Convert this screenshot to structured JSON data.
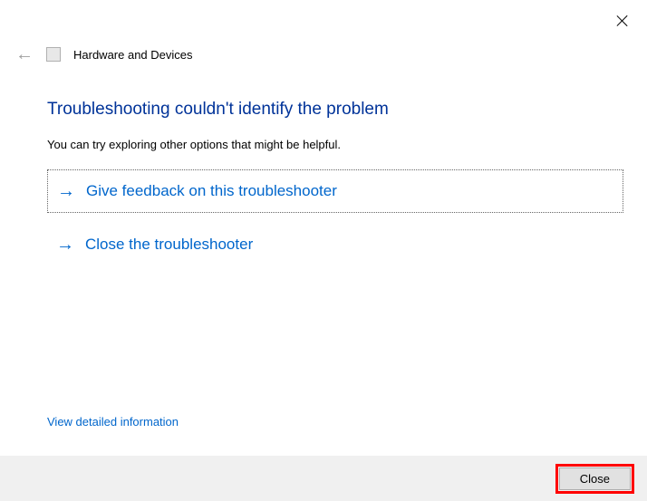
{
  "header": {
    "title": "Hardware and Devices"
  },
  "main": {
    "title": "Troubleshooting couldn't identify the problem",
    "subtitle": "You can try exploring other options that might be helpful.",
    "options": [
      "Give feedback on this troubleshooter",
      "Close the troubleshooter"
    ],
    "detail_link": "View detailed information"
  },
  "footer": {
    "close_label": "Close"
  }
}
